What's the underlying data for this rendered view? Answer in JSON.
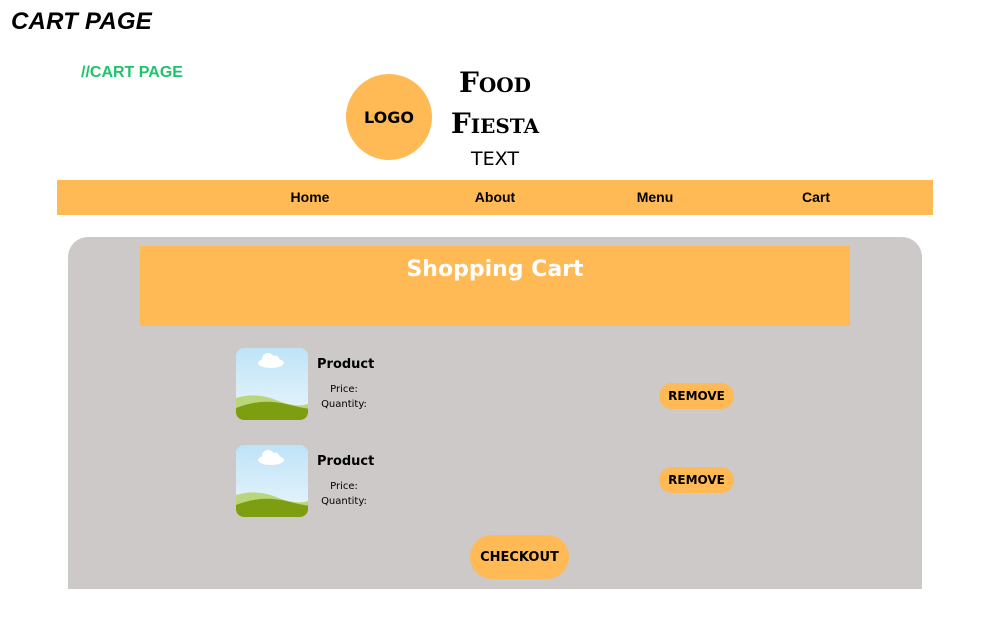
{
  "colors": {
    "accent": "#ffb955",
    "panel": "#cdc9c9",
    "comment": "#1fc36b"
  },
  "page_heading": "CART PAGE",
  "comment": "//CART PAGE",
  "logo": {
    "label": "LOGO"
  },
  "brand": {
    "line1": "Food",
    "line2": "Fiesta",
    "sub": "TEXT"
  },
  "nav": {
    "items": [
      "Home",
      "About",
      "Menu",
      "Cart"
    ]
  },
  "cart": {
    "title": "Shopping Cart",
    "items": [
      {
        "name": "Product",
        "price_label": "Price:",
        "quantity_label": "Quantity:",
        "remove_label": "REMOVE",
        "image_icon": "landscape-placeholder-icon"
      },
      {
        "name": "Product",
        "price_label": "Price:",
        "quantity_label": "Quantity:",
        "remove_label": "REMOVE",
        "image_icon": "landscape-placeholder-icon"
      }
    ],
    "checkout_label": "CHECKOUT"
  }
}
